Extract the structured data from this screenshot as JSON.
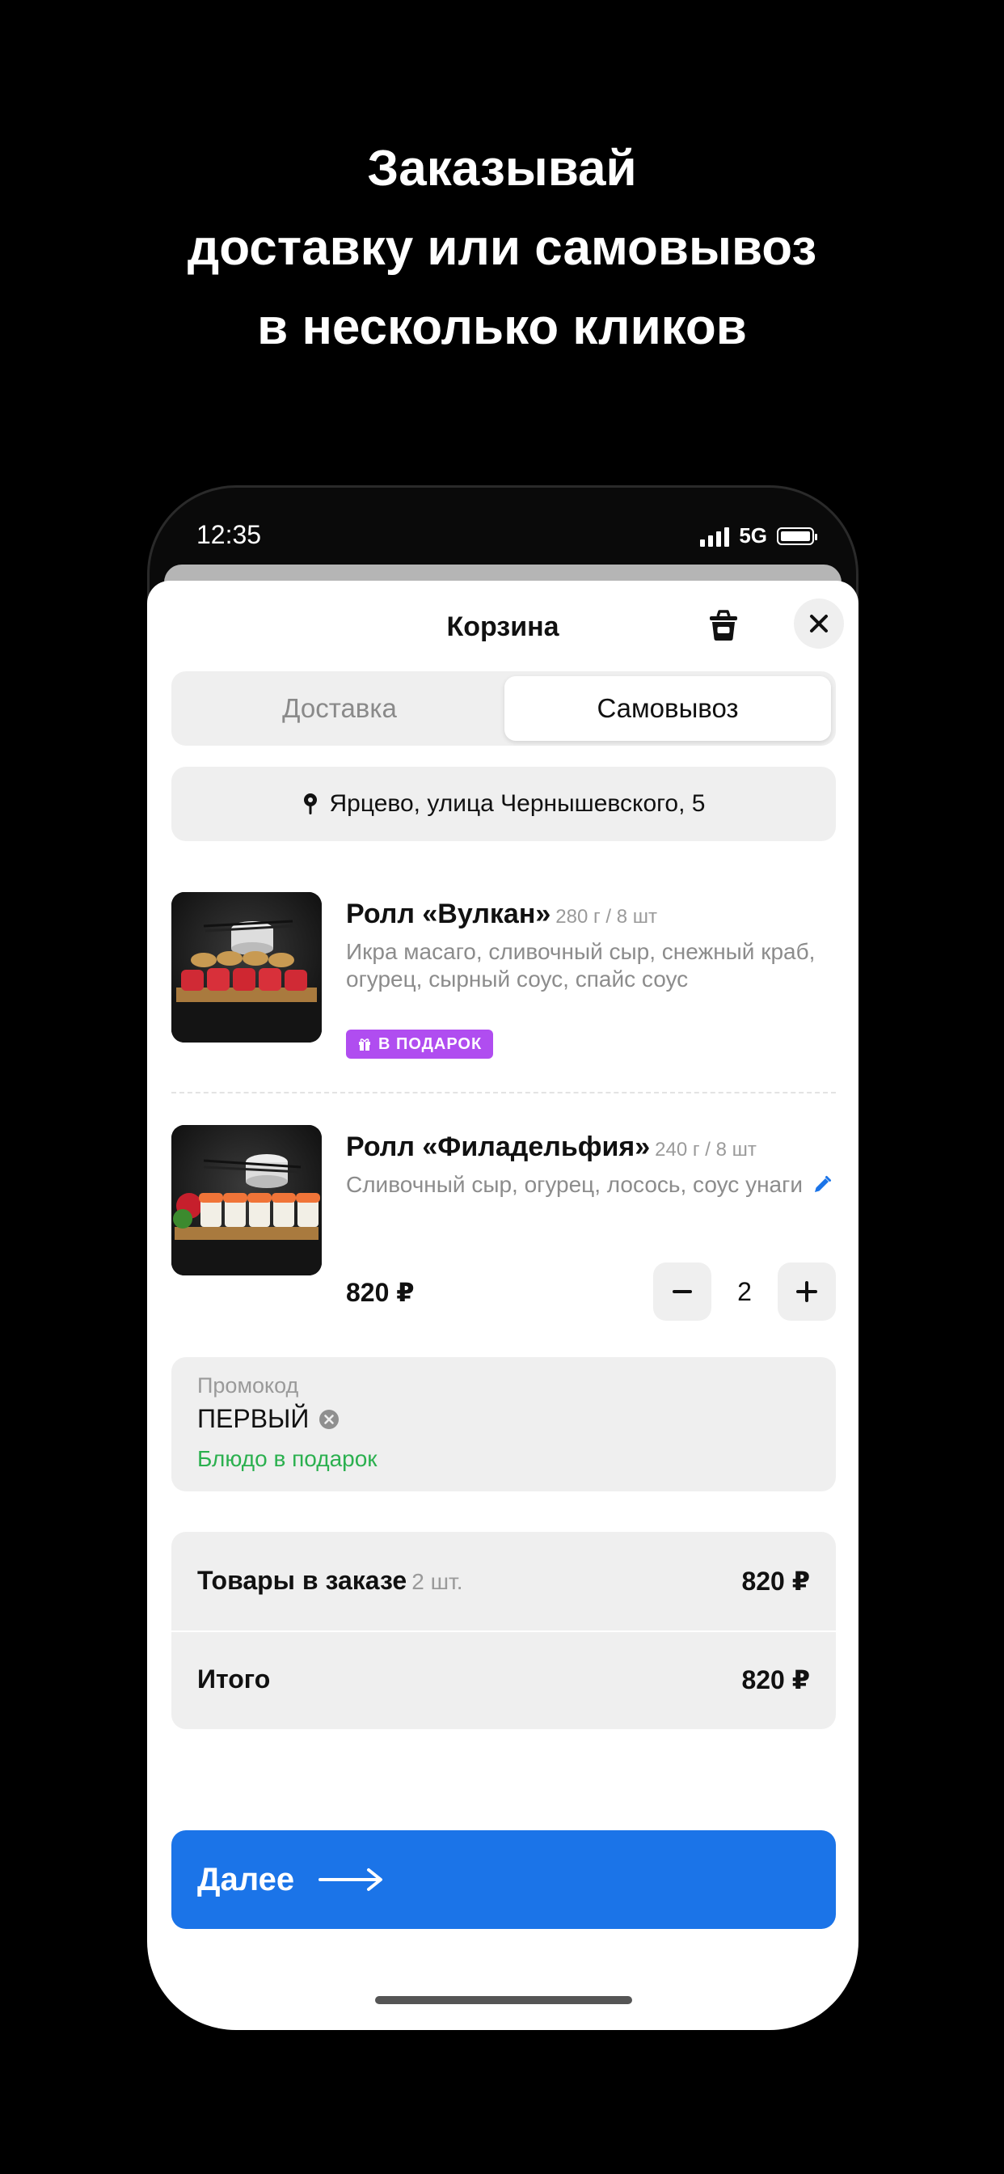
{
  "promo_header": {
    "line1": "Заказывай",
    "line2": "доставку или самовывоз",
    "line3": "в несколько кликов"
  },
  "status_bar": {
    "time": "12:35",
    "network": "5G"
  },
  "cart": {
    "title": "Корзина",
    "tabs": {
      "delivery": "Доставка",
      "pickup": "Самовывоз",
      "selected": "pickup"
    },
    "address": "Ярцево, улица Чернышевского, 5",
    "items": [
      {
        "name": "Ролл «Вулкан»",
        "weight": "280 г / 8 шт",
        "description": "Икра масаго, сливочный сыр, снежный краб, огурец, сырный соус, спайс соус",
        "badge": "В ПОДАРОК"
      },
      {
        "name": "Ролл «Филадельфия»",
        "weight": "240 г / 8 шт",
        "description": "Сливочный сыр, огурец, лосось, соус унаги",
        "price": "820 ₽",
        "quantity": "2"
      }
    ],
    "promo": {
      "label": "Промокод",
      "code": "ПЕРВЫЙ",
      "note": "Блюдо в подарок"
    },
    "summary": {
      "items_label": "Товары в заказе",
      "items_count": "2 шт.",
      "items_total": "820 ₽",
      "total_label": "Итого",
      "total_value": "820 ₽"
    },
    "next_button": "Далее"
  },
  "colors": {
    "accent_blue": "#1b74e8",
    "gift_purple": "#b04df0",
    "promo_green": "#2bb04f"
  }
}
